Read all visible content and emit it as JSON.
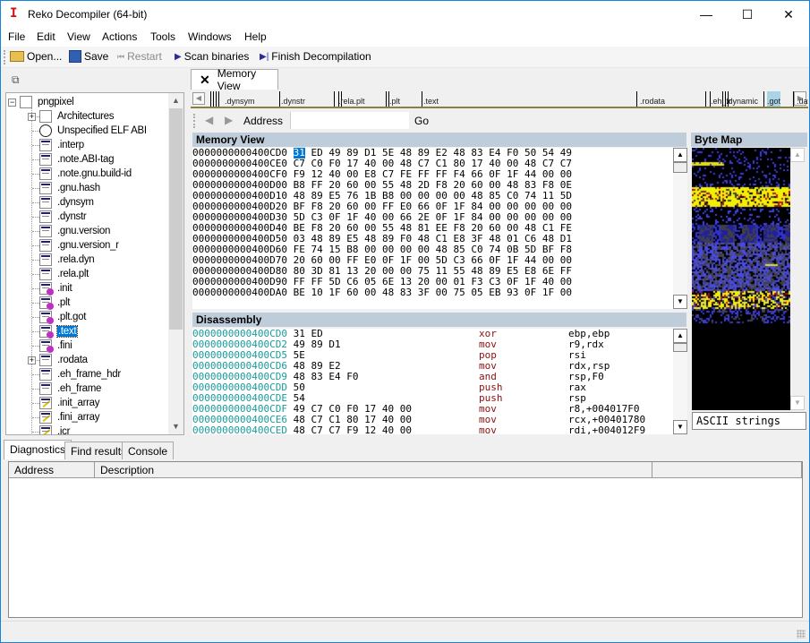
{
  "window": {
    "title": "Reko Decompiler (64-bit)",
    "controls": {
      "minimize": "—",
      "maximize": "☐",
      "close": "✕"
    }
  },
  "menu": [
    {
      "label": "File",
      "accel": "F"
    },
    {
      "label": "Edit",
      "accel": "E"
    },
    {
      "label": "View",
      "accel": "V"
    },
    {
      "label": "Actions",
      "accel": "A"
    },
    {
      "label": "Tools",
      "accel": "T"
    },
    {
      "label": "Windows",
      "accel": "W"
    },
    {
      "label": "Help",
      "accel": "H"
    }
  ],
  "toolbar": {
    "open": "Open...",
    "save": "Save",
    "restart": "Restart",
    "scan": "Scan binaries",
    "finish": "Finish Decompilation"
  },
  "tree": {
    "root": "pngpixel",
    "items": [
      {
        "label": "Architectures",
        "icon": "file-icon",
        "expandable": true
      },
      {
        "label": "Unspecified ELF ABI",
        "icon": "globe-icon"
      },
      {
        "label": ".interp",
        "icon": "section-icon"
      },
      {
        "label": ".note.ABI-tag",
        "icon": "section-icon"
      },
      {
        "label": ".note.gnu.build-id",
        "icon": "section-icon"
      },
      {
        "label": ".gnu.hash",
        "icon": "section-icon"
      },
      {
        "label": ".dynsym",
        "icon": "section-icon"
      },
      {
        "label": ".dynstr",
        "icon": "section-icon"
      },
      {
        "label": ".gnu.version",
        "icon": "section-icon"
      },
      {
        "label": ".gnu.version_r",
        "icon": "section-icon"
      },
      {
        "label": ".rela.dyn",
        "icon": "section-icon"
      },
      {
        "label": ".rela.plt",
        "icon": "section-icon"
      },
      {
        "label": ".init",
        "icon": "code-section-icon"
      },
      {
        "label": ".plt",
        "icon": "code-section-icon"
      },
      {
        "label": ".plt.got",
        "icon": "code-section-icon"
      },
      {
        "label": ".text",
        "icon": "code-section-icon",
        "selected": true
      },
      {
        "label": ".fini",
        "icon": "code-section-icon"
      },
      {
        "label": ".rodata",
        "icon": "section-icon",
        "expandable": true
      },
      {
        "label": ".eh_frame_hdr",
        "icon": "section-icon"
      },
      {
        "label": ".eh_frame",
        "icon": "section-icon"
      },
      {
        "label": ".init_array",
        "icon": "data-section-icon"
      },
      {
        "label": ".fini_array",
        "icon": "data-section-icon"
      },
      {
        "label": ".jcr",
        "icon": "data-section-icon"
      }
    ]
  },
  "doc_tab": {
    "label": "Memory View",
    "close": "✕"
  },
  "segments": [
    ".dynsym",
    ".dynstr",
    ".rela.plt",
    ".plt",
    ".text",
    ".rodata",
    ".eh_fr",
    ".dynamic",
    ".got",
    ".data"
  ],
  "address_bar": {
    "label": "Address",
    "value": "",
    "go": "Go"
  },
  "memory_view": {
    "title": "Memory View",
    "rows": [
      {
        "addr": "0000000000400CD0",
        "bytes": "31 ED 49 89 D1 5E 48 89 E2 48 83 E4 F0 50 54 49"
      },
      {
        "addr": "0000000000400CE0",
        "bytes": "C7 C0 F0 17 40 00 48 C7 C1 80 17 40 00 48 C7 C7"
      },
      {
        "addr": "0000000000400CF0",
        "bytes": "F9 12 40 00 E8 C7 FE FF FF F4 66 0F 1F 44 00 00"
      },
      {
        "addr": "0000000000400D00",
        "bytes": "B8 FF 20 60 00 55 48 2D F8 20 60 00 48 83 F8 0E"
      },
      {
        "addr": "0000000000400D10",
        "bytes": "48 89 E5 76 1B B8 00 00 00 00 48 85 C0 74 11 5D"
      },
      {
        "addr": "0000000000400D20",
        "bytes": "BF F8 20 60 00 FF E0 66 0F 1F 84 00 00 00 00 00"
      },
      {
        "addr": "0000000000400D30",
        "bytes": "5D C3 0F 1F 40 00 66 2E 0F 1F 84 00 00 00 00 00"
      },
      {
        "addr": "0000000000400D40",
        "bytes": "BE F8 20 60 00 55 48 81 EE F8 20 60 00 48 C1 FE"
      },
      {
        "addr": "0000000000400D50",
        "bytes": "03 48 89 E5 48 89 F0 48 C1 E8 3F 48 01 C6 48 D1"
      },
      {
        "addr": "0000000000400D60",
        "bytes": "FE 74 15 B8 00 00 00 00 48 85 C0 74 0B 5D BF F8"
      },
      {
        "addr": "0000000000400D70",
        "bytes": "20 60 00 FF E0 0F 1F 00 5D C3 66 0F 1F 44 00 00"
      },
      {
        "addr": "0000000000400D80",
        "bytes": "80 3D 81 13 20 00 00 75 11 55 48 89 E5 E8 6E FF"
      },
      {
        "addr": "0000000000400D90",
        "bytes": "FF FF 5D C6 05 6E 13 20 00 01 F3 C3 0F 1F 40 00"
      },
      {
        "addr": "0000000000400DA0",
        "bytes": "BE 10 1F 60 00 48 83 3F 00 75 05 EB 93 0F 1F 00"
      }
    ]
  },
  "disassembly": {
    "title": "Disassembly",
    "rows": [
      {
        "addr": "0000000000400CD0",
        "bytes": "31 ED",
        "mnemonic": "xor",
        "operands": "ebp,ebp"
      },
      {
        "addr": "0000000000400CD2",
        "bytes": "49 89 D1",
        "mnemonic": "mov",
        "operands": "r9,rdx"
      },
      {
        "addr": "0000000000400CD5",
        "bytes": "5E",
        "mnemonic": "pop",
        "operands": "rsi"
      },
      {
        "addr": "0000000000400CD6",
        "bytes": "48 89 E2",
        "mnemonic": "mov",
        "operands": "rdx,rsp"
      },
      {
        "addr": "0000000000400CD9",
        "bytes": "48 83 E4 F0",
        "mnemonic": "and",
        "operands": "rsp,F0"
      },
      {
        "addr": "0000000000400CDD",
        "bytes": "50",
        "mnemonic": "push",
        "operands": "rax"
      },
      {
        "addr": "0000000000400CDE",
        "bytes": "54",
        "mnemonic": "push",
        "operands": "rsp"
      },
      {
        "addr": "0000000000400CDF",
        "bytes": "49 C7 C0 F0 17 40 00",
        "mnemonic": "mov",
        "operands": "r8,+004017F0"
      },
      {
        "addr": "0000000000400CE6",
        "bytes": "48 C7 C1 80 17 40 00",
        "mnemonic": "mov",
        "operands": "rcx,+00401780"
      },
      {
        "addr": "0000000000400CED",
        "bytes": "48 C7 C7 F9 12 40 00",
        "mnemonic": "mov",
        "operands": "rdi,+004012F9"
      }
    ]
  },
  "byte_map": {
    "title": "Byte Map",
    "mode": "ASCII strings"
  },
  "bottom_tabs": [
    "Diagnostics",
    "Find results",
    "Console"
  ],
  "diagnostics": {
    "columns": [
      "Address",
      "Description"
    ],
    "rows": []
  }
}
